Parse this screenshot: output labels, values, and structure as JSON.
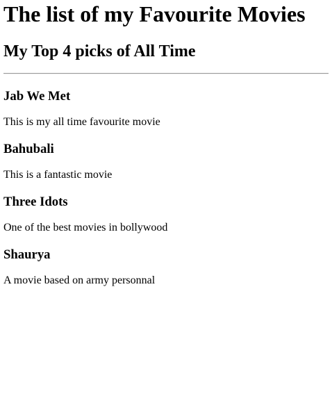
{
  "page": {
    "title": "The list of my Favourite Movies",
    "subtitle": "My Top 4 picks of All Time"
  },
  "movies": [
    {
      "name": "Jab We Met",
      "description": "This is my all time favourite movie"
    },
    {
      "name": "Bahubali",
      "description": "This is a fantastic movie"
    },
    {
      "name": "Three Idots",
      "description": "One of the best movies in bollywood"
    },
    {
      "name": "Shaurya",
      "description": "A movie based on army personnal"
    }
  ]
}
